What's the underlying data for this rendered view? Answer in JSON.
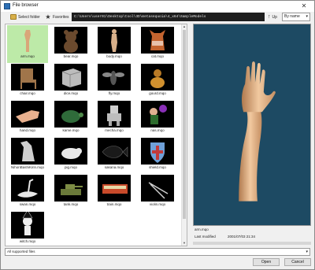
{
  "window": {
    "title": "File browser",
    "close_glyph": "✕"
  },
  "toolbar": {
    "select_folder": "Select folder",
    "favorites": "Favorites",
    "path": "C:\\Users\\user01\\Desktop\\tool\\3D\\metasequoia\\4_x64\\SampleModels",
    "up": "Up",
    "sort": "By name"
  },
  "files": [
    {
      "label": "arm.mqo",
      "selected": true,
      "icon": "arm-model"
    },
    {
      "label": "bear.mqo",
      "icon": "bear-model"
    },
    {
      "label": "body.mqo",
      "icon": "body-model"
    },
    {
      "label": "cat.mqo",
      "icon": "cat-model"
    },
    {
      "label": "chair.mqo",
      "icon": "chair-model"
    },
    {
      "label": "dice.mqo",
      "icon": "dice-model"
    },
    {
      "label": "fly.mqo",
      "icon": "fly-model"
    },
    {
      "label": "gourd.mqo",
      "icon": "gourd-model"
    },
    {
      "label": "hand.mqo",
      "icon": "hand-model"
    },
    {
      "label": "kame.mqo",
      "icon": "kame-model"
    },
    {
      "label": "mecha.mqo",
      "icon": "mecha-model"
    },
    {
      "label": "nas.mqo",
      "icon": "nas-model"
    },
    {
      "label": "NihonBashiKirin.mqo",
      "icon": "kirin-model"
    },
    {
      "label": "pig.mqo",
      "icon": "pig-model"
    },
    {
      "label": "sakana.mqo",
      "icon": "sakana-model"
    },
    {
      "label": "shield.mqo",
      "icon": "shield-model"
    },
    {
      "label": "swan.mqo",
      "icon": "swan-model"
    },
    {
      "label": "tank.mqo",
      "icon": "tank-model"
    },
    {
      "label": "train.mqo",
      "icon": "train-model"
    },
    {
      "label": "violin.mqo",
      "icon": "violin-model"
    },
    {
      "label": "witch.mqo",
      "icon": "witch-model"
    }
  ],
  "preview": {
    "filename": "arm.mqo",
    "modified_label": "Last modified",
    "modified_value": "2001/07/03 21:34",
    "bg_color": "#1d4a63"
  },
  "filter": {
    "value": "All supported files"
  },
  "buttons": {
    "open": "Open",
    "cancel": "Cancel"
  },
  "colors": {
    "selection": "#bdeaa8",
    "thumb_bg": "#000000"
  }
}
